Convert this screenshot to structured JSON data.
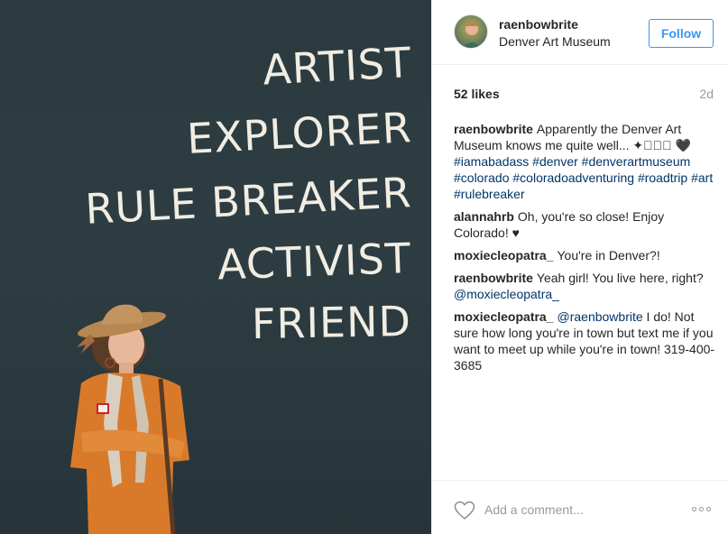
{
  "photo": {
    "wall_lines": [
      "ARTIST",
      "EXPLORER",
      "RULE BREAKER",
      "ACTIVIST",
      "FRIEND"
    ]
  },
  "post": {
    "username": "raenbowbrite",
    "location": "Denver Art Museum",
    "follow_label": "Follow",
    "likes": "52 likes",
    "time": "2d"
  },
  "caption": {
    "user": "raenbowbrite",
    "text": "Apparently the Denver Art Museum knows me quite well... ✦⁺⃞⃞ 🖤",
    "hashtags": [
      "#iamabadass",
      "#denver",
      "#denverartmuseum",
      "#colorado",
      "#coloradoadventuring",
      "#roadtrip",
      "#art",
      "#rulebreaker"
    ]
  },
  "comments": [
    {
      "user": "alannahrb",
      "text": "Oh, you're so close! Enjoy Colorado! ♥"
    },
    {
      "user": "moxiecleopatra_",
      "text": "You're in Denver?!"
    },
    {
      "user": "raenbowbrite",
      "text": "Yeah girl! You live here, right?",
      "mention": "@moxiecleopatra_"
    },
    {
      "user": "moxiecleopatra_",
      "mention": "@raenbowbrite",
      "text": "I do! Not sure how long you're in town but text me if you want to meet up while you're in town! 319-400-3685"
    }
  ],
  "footer": {
    "placeholder": "Add a comment...",
    "heart_icon": "heart-outline-icon",
    "more_icon": "more-options-icon"
  },
  "colors": {
    "accent": "#3897f0",
    "link": "#003569",
    "muted": "#999999",
    "wall": "#2b3a3f"
  }
}
